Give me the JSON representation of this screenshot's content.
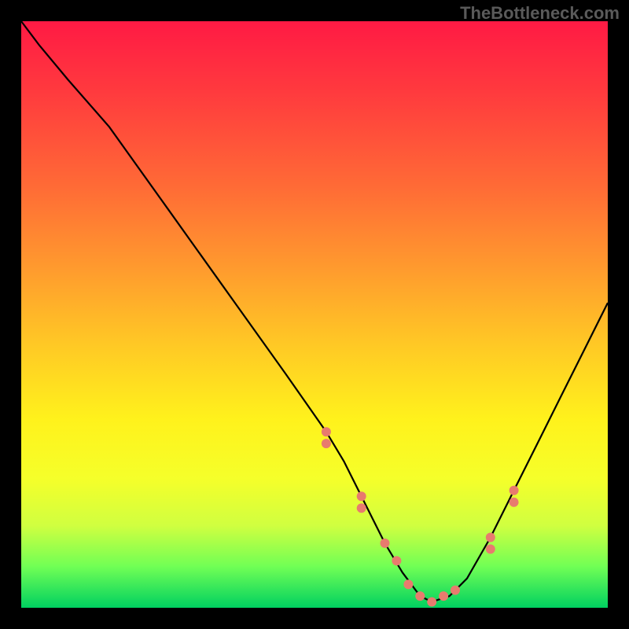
{
  "watermark": "TheBottleneck.com",
  "chart_data": {
    "type": "line",
    "title": "",
    "xlabel": "",
    "ylabel": "",
    "xlim": [
      0,
      100
    ],
    "ylim": [
      0,
      100
    ],
    "grid": false,
    "note": "Axis values estimated from pixel positions of a V-shaped bottleneck curve on a heat-gradient background. y≈100 is top (worst/red), y≈0 is bottom (best/green). Minimum of V is around x≈69.",
    "series": [
      {
        "name": "bottleneck-curve",
        "x": [
          0,
          3,
          8,
          15,
          25,
          35,
          45,
          52,
          55,
          58,
          60,
          62,
          65,
          68,
          70,
          73,
          76,
          80,
          84,
          88,
          92,
          96,
          100
        ],
        "y": [
          100,
          96,
          90,
          82,
          68,
          54,
          40,
          30,
          25,
          19,
          15,
          11,
          6,
          2,
          1,
          2,
          5,
          12,
          20,
          28,
          36,
          44,
          52
        ]
      }
    ],
    "markers": {
      "name": "highlight-points",
      "note": "Salmon dot clusters along the curve at roughly these x positions",
      "x": [
        52,
        52,
        58,
        58,
        62,
        64,
        66,
        68,
        70,
        72,
        74,
        80,
        80,
        84,
        84
      ],
      "y": [
        30,
        28,
        19,
        17,
        11,
        8,
        4,
        2,
        1,
        2,
        3,
        12,
        10,
        20,
        18
      ]
    },
    "gradient_stops": [
      {
        "pos": 0,
        "color": "#ff1a44"
      },
      {
        "pos": 28,
        "color": "#ff6a36"
      },
      {
        "pos": 55,
        "color": "#ffc825"
      },
      {
        "pos": 78,
        "color": "#f5ff2a"
      },
      {
        "pos": 100,
        "color": "#00d060"
      }
    ]
  }
}
